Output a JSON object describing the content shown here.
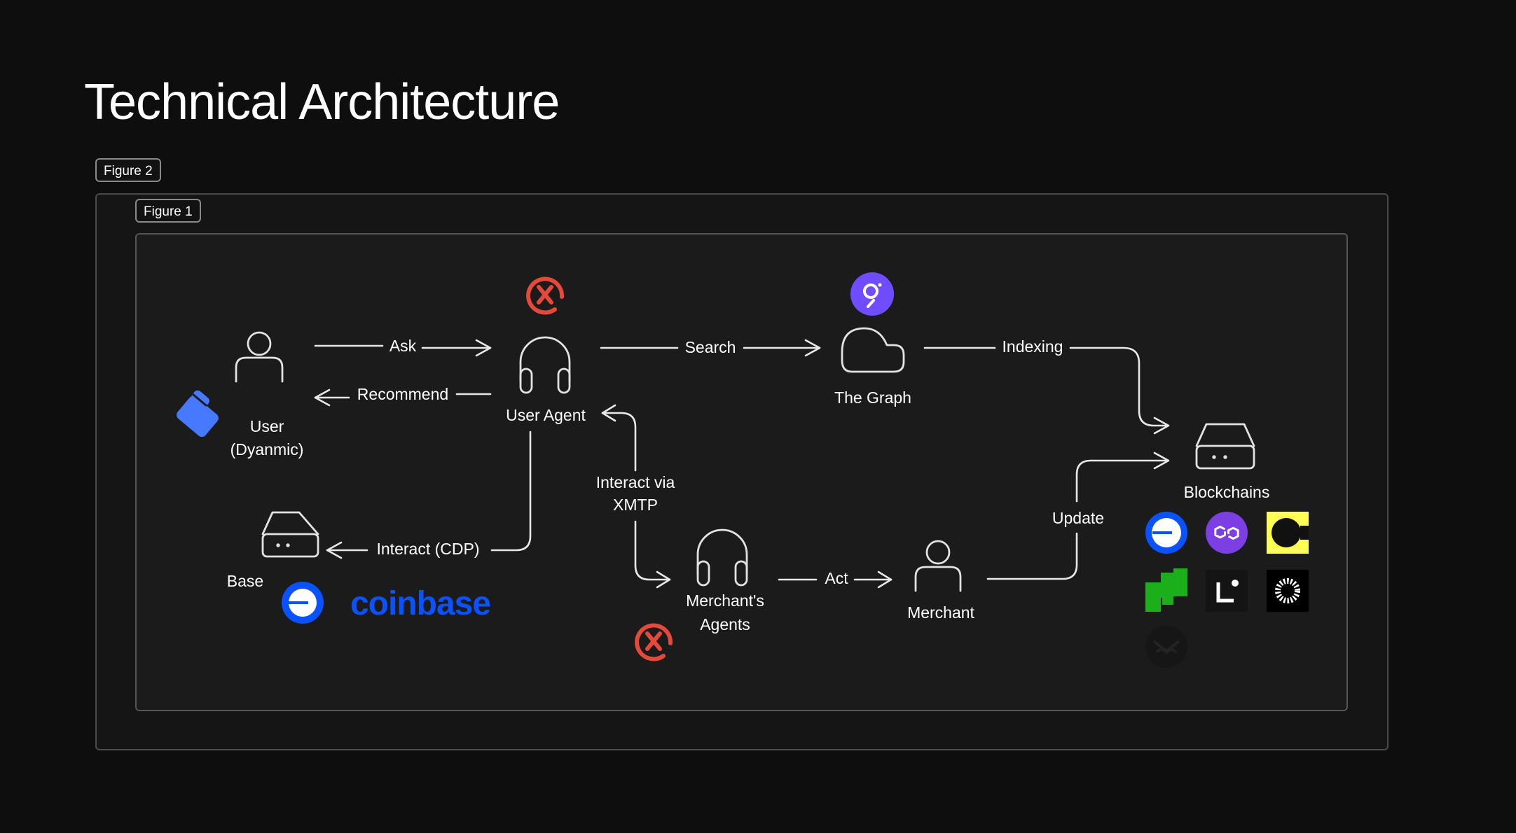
{
  "page": {
    "title": "Technical Architecture",
    "figure2_label": "Figure 2",
    "figure1_label": "Figure 1"
  },
  "nodes": {
    "user": {
      "label_line1": "User",
      "label_line2": "(Dyanmic)",
      "icon": "person-icon",
      "logo": "dynamic-logo"
    },
    "user_agent": {
      "label": "User Agent",
      "icon": "headphones-icon",
      "logo": "xmtp-logo"
    },
    "the_graph": {
      "label": "The Graph",
      "icon": "cloud-icon",
      "logo": "the-graph-logo"
    },
    "blockchains": {
      "label": "Blockchains",
      "icon": "server-icon"
    },
    "base": {
      "label": "Base",
      "icon": "server-icon",
      "logo_text": "coinbase"
    },
    "merchants_agents": {
      "label_line1": "Merchant's",
      "label_line2": "Agents",
      "icon": "headphones-icon",
      "logo": "xmtp-logo"
    },
    "merchant": {
      "label": "Merchant",
      "icon": "person-icon"
    }
  },
  "edges": {
    "ask": "Ask",
    "recommend": "Recommend",
    "search": "Search",
    "indexing": "Indexing",
    "interact_cdp": "Interact (CDP)",
    "interact_xmtp_line1": "Interact via",
    "interact_xmtp_line2": "XMTP",
    "act": "Act",
    "update": "Update"
  },
  "blockchain_logos": [
    "base-logo",
    "polygon-logo",
    "celo-logo",
    "green-chain-logo",
    "linea-logo",
    "starburst-chain-logo",
    "owl-chain-logo"
  ],
  "colors": {
    "background": "#0e0e0f",
    "frame": "#1b1b1c",
    "xmtp": "#e5493a",
    "graph": "#6f4cff",
    "coinbase": "#0b52ff",
    "dynamic": "#4779ff",
    "polygon": "#7b3fe4",
    "celo": "#fcff52",
    "green": "#1bb01b"
  }
}
